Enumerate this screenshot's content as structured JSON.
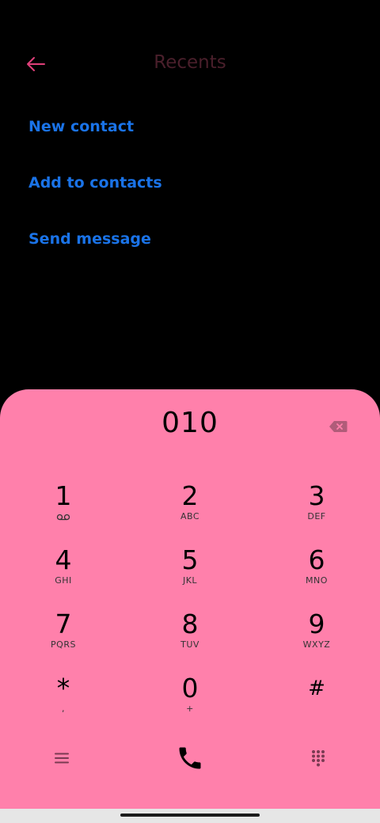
{
  "header": {
    "title": "Recents"
  },
  "actions": [
    {
      "label": "New contact"
    },
    {
      "label": "Add to contacts"
    },
    {
      "label": "Send message"
    }
  ],
  "dialpad": {
    "number": "010",
    "keys": [
      {
        "digit": "1",
        "sub": ""
      },
      {
        "digit": "2",
        "sub": "ABC"
      },
      {
        "digit": "3",
        "sub": "DEF"
      },
      {
        "digit": "4",
        "sub": "GHI"
      },
      {
        "digit": "5",
        "sub": "JKL"
      },
      {
        "digit": "6",
        "sub": "MNO"
      },
      {
        "digit": "7",
        "sub": "PQRS"
      },
      {
        "digit": "8",
        "sub": "TUV"
      },
      {
        "digit": "9",
        "sub": "WXYZ"
      },
      {
        "digit": "*",
        "sub": ","
      },
      {
        "digit": "0",
        "sub": "+"
      },
      {
        "digit": "#",
        "sub": ""
      }
    ]
  },
  "colors": {
    "accent": "#ff80ab",
    "link": "#1a73e8",
    "title": "#4a1f2b",
    "back_arrow": "#e0407a"
  },
  "icons": {
    "back": "arrow-left-icon",
    "backspace": "backspace-icon",
    "voicemail": "voicemail-icon",
    "menu": "menu-icon",
    "call": "phone-icon",
    "keypad": "dialpad-icon"
  }
}
